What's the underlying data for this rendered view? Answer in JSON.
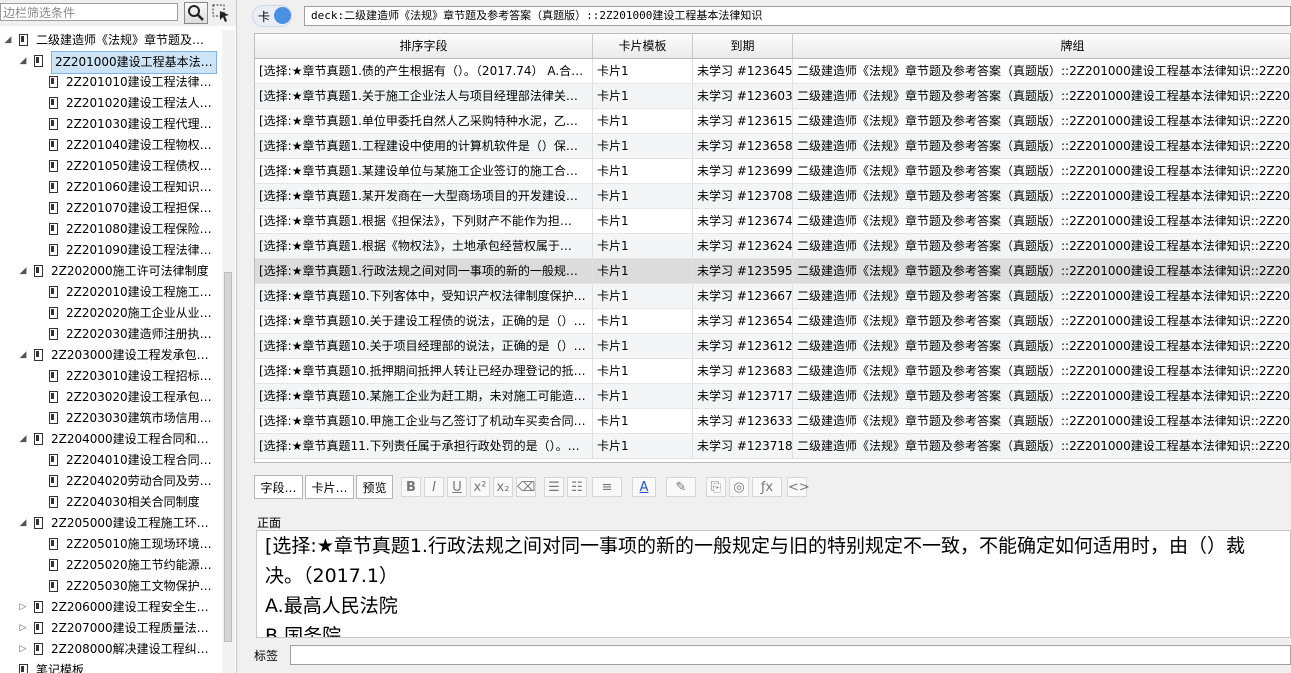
{
  "sidebar": {
    "filter_placeholder": "边栏筛选条件",
    "items": [
      {
        "label": "二级建造师《法规》章节题及…",
        "level": 0,
        "arrow": "◢"
      },
      {
        "label": "2Z201000建设工程基本法…",
        "level": 1,
        "arrow": "◢"
      },
      {
        "label": "2Z201010建设工程法律…",
        "level": 2,
        "arrow": ""
      },
      {
        "label": "2Z201020建设工程法人…",
        "level": 2,
        "arrow": ""
      },
      {
        "label": "2Z201030建设工程代理…",
        "level": 2,
        "arrow": ""
      },
      {
        "label": "2Z201040建设工程物权…",
        "level": 2,
        "arrow": ""
      },
      {
        "label": "2Z201050建设工程债权…",
        "level": 2,
        "arrow": ""
      },
      {
        "label": "2Z201060建设工程知识…",
        "level": 2,
        "arrow": ""
      },
      {
        "label": "2Z201070建设工程担保…",
        "level": 2,
        "arrow": ""
      },
      {
        "label": "2Z201080建设工程保险…",
        "level": 2,
        "arrow": ""
      },
      {
        "label": "2Z201090建设工程法律…",
        "level": 2,
        "arrow": ""
      },
      {
        "label": "2Z202000施工许可法律制度",
        "level": 1,
        "arrow": "◢"
      },
      {
        "label": "2Z202010建设工程施工…",
        "level": 2,
        "arrow": ""
      },
      {
        "label": "2Z202020施工企业从业…",
        "level": 2,
        "arrow": ""
      },
      {
        "label": "2Z202030建造师注册执…",
        "level": 2,
        "arrow": ""
      },
      {
        "label": "2Z203000建设工程发承包…",
        "level": 1,
        "arrow": "◢"
      },
      {
        "label": "2Z203010建设工程招标…",
        "level": 2,
        "arrow": ""
      },
      {
        "label": "2Z203020建设工程承包…",
        "level": 2,
        "arrow": ""
      },
      {
        "label": "2Z203030建筑市场信用…",
        "level": 2,
        "arrow": ""
      },
      {
        "label": "2Z204000建设工程合同和…",
        "level": 1,
        "arrow": "◢"
      },
      {
        "label": "2Z204010建设工程合同…",
        "level": 2,
        "arrow": ""
      },
      {
        "label": "2Z204020劳动合同及劳…",
        "level": 2,
        "arrow": ""
      },
      {
        "label": "2Z204030相关合同制度",
        "level": 2,
        "arrow": ""
      },
      {
        "label": "2Z205000建设工程施工环…",
        "level": 1,
        "arrow": "◢"
      },
      {
        "label": "2Z205010施工现场环境…",
        "level": 2,
        "arrow": ""
      },
      {
        "label": "2Z205020施工节约能源…",
        "level": 2,
        "arrow": ""
      },
      {
        "label": "2Z205030施工文物保护…",
        "level": 2,
        "arrow": ""
      },
      {
        "label": "2Z206000建设工程安全生…",
        "level": 1,
        "arrow": "▷"
      },
      {
        "label": "2Z207000建设工程质量法…",
        "level": 1,
        "arrow": "▷"
      },
      {
        "label": "2Z208000解决建设工程纠…",
        "level": 1,
        "arrow": "▷"
      },
      {
        "label": "笔记模板",
        "level": 0,
        "arrow": ""
      }
    ]
  },
  "topbar": {
    "toggle_label": "卡",
    "search_value": "deck:二级建造师《法规》章节题及参考答案（真题版）::2Z201000建设工程基本法律知识"
  },
  "table": {
    "columns": [
      "排序字段",
      "卡片模板",
      "到期",
      "牌组"
    ],
    "rows": [
      [
        "[选择:★章节真题1.债的产生根据有（）。（2017.74） A.合…",
        "卡片1",
        "未学习 #123645",
        "二级建造师《法规》章节题及参考答案（真题版）::2Z201000建设工程基本法律知识::2Z2010…"
      ],
      [
        "[选择:★章节真题1.关于施工企业法人与项目经理部法律关…",
        "卡片1",
        "未学习 #123603",
        "二级建造师《法规》章节题及参考答案（真题版）::2Z201000建设工程基本法律知识::2Z2010…"
      ],
      [
        "[选择:★章节真题1.单位甲委托自然人乙采购特种水泥，乙…",
        "卡片1",
        "未学习 #123615",
        "二级建造师《法规》章节题及参考答案（真题版）::2Z201000建设工程基本法律知识::2Z2010…"
      ],
      [
        "[选择:★章节真题1.工程建设中使用的计算机软件是（）保…",
        "卡片1",
        "未学习 #123658",
        "二级建造师《法规》章节题及参考答案（真题版）::2Z201000建设工程基本法律知识::2Z2010…"
      ],
      [
        "[选择:★章节真题1.某建设单位与某施工企业签订的施工合…",
        "卡片1",
        "未学习 #123699",
        "二级建造师《法规》章节题及参考答案（真题版）::2Z201000建设工程基本法律知识::2Z2010…"
      ],
      [
        "[选择:★章节真题1.某开发商在一大型商场项目的开发建设…",
        "卡片1",
        "未学习 #123708",
        "二级建造师《法规》章节题及参考答案（真题版）::2Z201000建设工程基本法律知识::2Z2010…"
      ],
      [
        "[选择:★章节真题1.根据《担保法》，下列财产不能作为担…",
        "卡片1",
        "未学习 #123674",
        "二级建造师《法规》章节题及参考答案（真题版）::2Z201000建设工程基本法律知识::2Z2010…"
      ],
      [
        "[选择:★章节真题1.根据《物权法》，土地承包经营权属于…",
        "卡片1",
        "未学习 #123624",
        "二级建造师《法规》章节题及参考答案（真题版）::2Z201000建设工程基本法律知识::2Z2010…"
      ],
      [
        "[选择:★章节真题1.行政法规之间对同一事项的新的一般规…",
        "卡片1",
        "未学习 #123595",
        "二级建造师《法规》章节题及参考答案（真题版）::2Z201000建设工程基本法律知识::2Z2010…"
      ],
      [
        "[选择:★章节真题10.下列客体中，受知识产权法律制度保护…",
        "卡片1",
        "未学习 #123667",
        "二级建造师《法规》章节题及参考答案（真题版）::2Z201000建设工程基本法律知识::2Z2010…"
      ],
      [
        "[选择:★章节真题10.关于建设工程债的说法，正确的是（）…",
        "卡片1",
        "未学习 #123654",
        "二级建造师《法规》章节题及参考答案（真题版）::2Z201000建设工程基本法律知识::2Z2010…"
      ],
      [
        "[选择:★章节真题10.关于项目经理部的说法，正确的是（）…",
        "卡片1",
        "未学习 #123612",
        "二级建造师《法规》章节题及参考答案（真题版）::2Z201000建设工程基本法律知识::2Z2010…"
      ],
      [
        "[选择:★章节真题10.抵押期间抵押人转让已经办理登记的抵…",
        "卡片1",
        "未学习 #123683",
        "二级建造师《法规》章节题及参考答案（真题版）::2Z201000建设工程基本法律知识::2Z2010…"
      ],
      [
        "[选择:★章节真题10.某施工企业为赶工期，未对施工可能造…",
        "卡片1",
        "未学习 #123717",
        "二级建造师《法规》章节题及参考答案（真题版）::2Z201000建设工程基本法律知识::2Z2010…"
      ],
      [
        "[选择:★章节真题10.甲施工企业与乙签订了机动车买卖合同…",
        "卡片1",
        "未学习 #123633",
        "二级建造师《法规》章节题及参考答案（真题版）::2Z201000建设工程基本法律知识::2Z2010…"
      ],
      [
        "[选择:★章节真题11.下列责任属于承担行政处罚的是（）。…",
        "卡片1",
        "未学习 #123718",
        "二级建造师《法规》章节题及参考答案（真题版）::2Z201000建设工程基本法律知识::2Z2010…"
      ]
    ],
    "selected_index": 8
  },
  "editor_toolbar": {
    "fields_label": "字段…",
    "cards_label": "卡片…",
    "preview_label": "预览",
    "icons": [
      "bold-icon",
      "italic-icon",
      "underline-icon",
      "superscript-icon",
      "subscript-icon",
      "eraser-icon",
      "bullet-list-icon",
      "numbered-list-icon",
      "align-icon",
      "text-color-icon",
      "highlight-icon",
      "attach-icon",
      "record-icon",
      "formula-icon",
      "html-icon"
    ]
  },
  "editor": {
    "field_name": "正面",
    "lines": [
      "[选择:★章节真题1.行政法规之间对同一事项的新的一般规定与旧的特别规定不一致，不能确定如何适用时，由（）裁",
      "决。（2017.1）",
      "A.最高人民法院",
      "B.国务院"
    ]
  },
  "tags": {
    "label": "标签",
    "value": ""
  }
}
